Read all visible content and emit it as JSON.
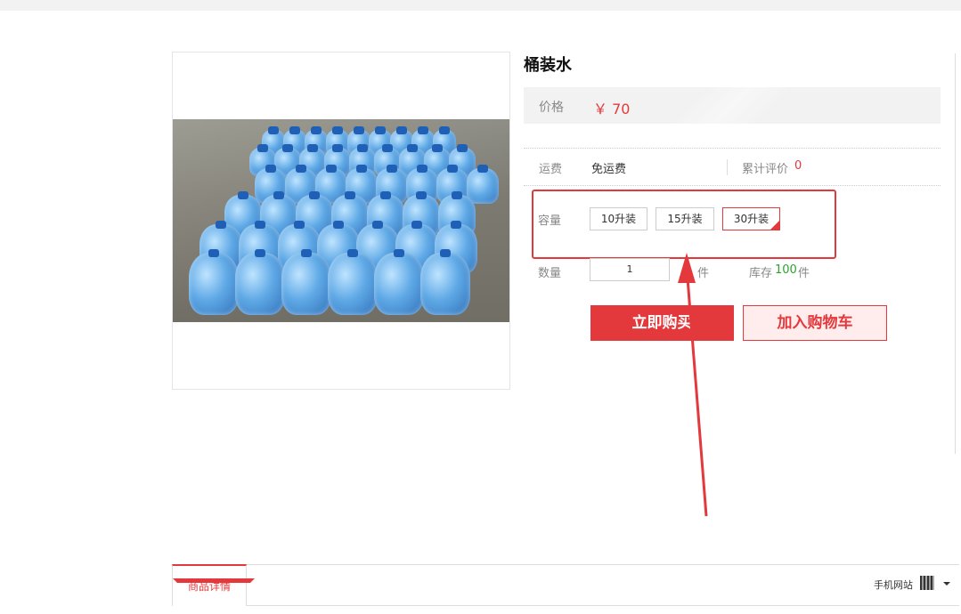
{
  "product": {
    "title": "桶装水",
    "price_label": "价格",
    "price_value": "￥ 70",
    "shipping_label": "运费",
    "shipping_value": "免运费",
    "review_label": "累计评价",
    "review_count": "0",
    "capacity_label": "容量",
    "capacity_options": [
      {
        "label": "10升装",
        "selected": false
      },
      {
        "label": "15升装",
        "selected": false
      },
      {
        "label": "30升装",
        "selected": true
      }
    ],
    "quantity_label": "数量",
    "quantity_value": "1",
    "quantity_unit": "件",
    "stock_label": "库存",
    "stock_count": "100",
    "stock_unit": "件",
    "buy_now_label": "立即购买",
    "add_to_cart_label": "加入购物车"
  },
  "tabs": {
    "active": "商品详情",
    "mobile_site": "手机网站"
  },
  "colors": {
    "accent": "#e4393c",
    "stock": "#2ba52b",
    "annotation": "#e4393c"
  }
}
